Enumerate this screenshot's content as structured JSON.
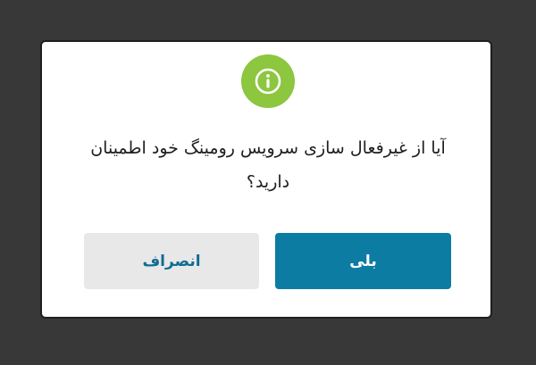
{
  "dialog": {
    "icon": "info-icon",
    "accent_color": "#8dc63f",
    "message": "آیا از غیرفعال سازی سرویس رومینگ خود اطمینان دارید؟",
    "cancel_label": "انصراف",
    "confirm_label": "بلی",
    "confirm_color": "#0c7ca3",
    "cancel_color": "#e8e8e8"
  }
}
